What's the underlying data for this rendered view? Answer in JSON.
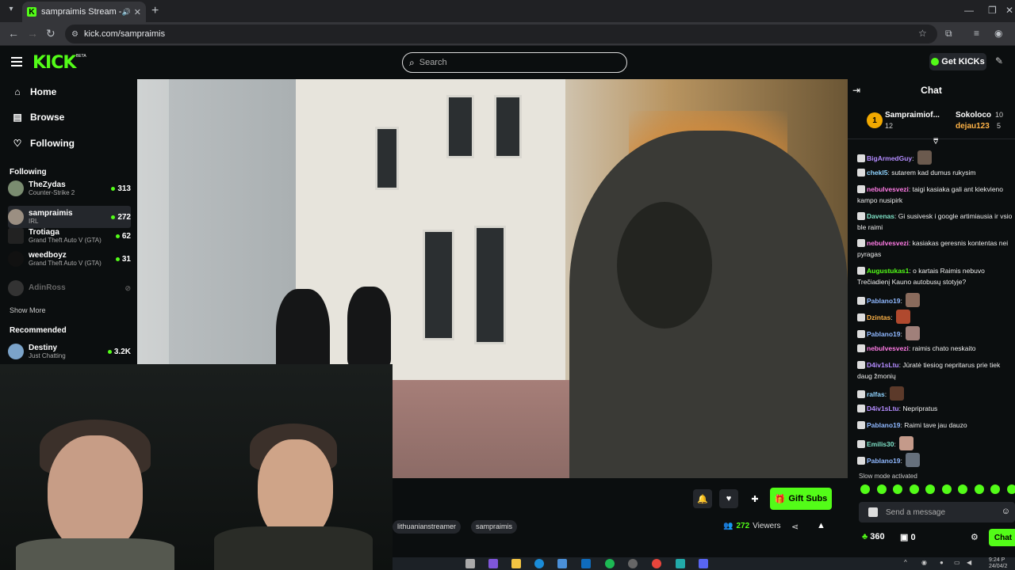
{
  "browser": {
    "tab_title": "sampraimis Stream - Watch",
    "url": "kick.com/sampraimis"
  },
  "header": {
    "logo": "KICK",
    "logo_badge": "BETA",
    "search_placeholder": "Search",
    "get_kicks_label": "Get KICKs"
  },
  "sidebar": {
    "nav": [
      {
        "label": "Home",
        "icon": "home-icon"
      },
      {
        "label": "Browse",
        "icon": "browse-icon"
      },
      {
        "label": "Following",
        "icon": "heart-icon"
      }
    ],
    "following_heading": "Following",
    "following": [
      {
        "name": "TheZydas",
        "category": "Counter-Strike 2",
        "viewers": "313"
      },
      {
        "name": "sampraimis",
        "category": "IRL",
        "viewers": "272"
      },
      {
        "name": "Trotiaga",
        "category": "Grand Theft Auto V (GTA)",
        "viewers": "62"
      },
      {
        "name": "weedboyz",
        "category": "Grand Theft Auto V (GTA)",
        "viewers": "31"
      },
      {
        "name": "AdinRoss",
        "category": "",
        "viewers": ""
      }
    ],
    "show_more": "Show More",
    "recommended_heading": "Recommended",
    "recommended": [
      {
        "name": "Destiny",
        "category": "Just Chatting",
        "viewers": "3.2K"
      }
    ]
  },
  "stream": {
    "gift_subs_label": "Gift Subs",
    "tags": [
      "lithuanianstreamer",
      "sampraimis"
    ],
    "viewers_count": "272",
    "viewers_label": "Viewers"
  },
  "chat": {
    "title": "Chat",
    "leaderboard": [
      {
        "name": "Sampraimiof...",
        "count": "12"
      },
      {
        "name": "Sokoloco",
        "count": "10"
      },
      {
        "name": "dejau123",
        "count": "5"
      }
    ],
    "messages": [
      {
        "user": "BigArmedGuy",
        "text": "",
        "color": "#b48cff"
      },
      {
        "user": "chekl5",
        "text": "sutarem kad dumus rukysim",
        "color": "#8fd3ff"
      },
      {
        "user": "nebulvesvezi",
        "text": "taigi kasiaka gali ant kiekvieno",
        "color": "#ff7be5"
      },
      {
        "user": "",
        "text": "kampo nusipirk",
        "color": "#ffffff"
      },
      {
        "user": "Davenas",
        "text": "Gi susivesk i google artimiausia ir vsio",
        "color": "#7fe3c8"
      },
      {
        "user": "",
        "text": "ble raimi",
        "color": "#ffffff"
      },
      {
        "user": "nebulvesvezi",
        "text": "kasiakas geresnis kontentas nei",
        "color": "#ff7be5"
      },
      {
        "user": "",
        "text": "pyragas",
        "color": "#ffffff"
      },
      {
        "user": "Augustukas1",
        "text": "o kartais Raimis nebuvo",
        "color": "#53fc18"
      },
      {
        "user": "",
        "text": "Trečiadienį Kauno autobusų stotyje?",
        "color": "#ffffff"
      },
      {
        "user": "Pablano19",
        "text": "",
        "color": "#8fb8ff"
      },
      {
        "user": "Dzintas",
        "text": "",
        "color": "#ffb347"
      },
      {
        "user": "Pablano19",
        "text": "",
        "color": "#8fb8ff"
      },
      {
        "user": "nebulvesvezi",
        "text": "raimis chato neskaito",
        "color": "#ff7be5"
      },
      {
        "user": "D4iv1sLtu",
        "text": "Jūratė tiesiog nepritarus prie tiek",
        "color": "#b48cff"
      },
      {
        "user": "",
        "text": "daug žmonių",
        "color": "#ffffff"
      },
      {
        "user": "ralfas",
        "text": "",
        "color": "#8fd3ff"
      },
      {
        "user": "D4iv1sLtu",
        "text": "Nepripratus",
        "color": "#b48cff"
      },
      {
        "user": "Pablano19",
        "text": "Raimi tave jau dauzo",
        "color": "#8fb8ff"
      },
      {
        "user": "Emilis30",
        "text": "",
        "color": "#7fe3c8"
      },
      {
        "user": "Pablano19",
        "text": "",
        "color": "#8fb8ff"
      }
    ],
    "slow_mode": "Slow mode activated",
    "input_placeholder": "Send a message",
    "points": "360",
    "gifts": "0",
    "send_label": "Chat"
  },
  "taskbar": {
    "time": "9:24 P",
    "date": "24/04/2"
  },
  "colors": {
    "brand": "#53fc18",
    "background": "#0b0e0f",
    "surface": "#24272c"
  }
}
